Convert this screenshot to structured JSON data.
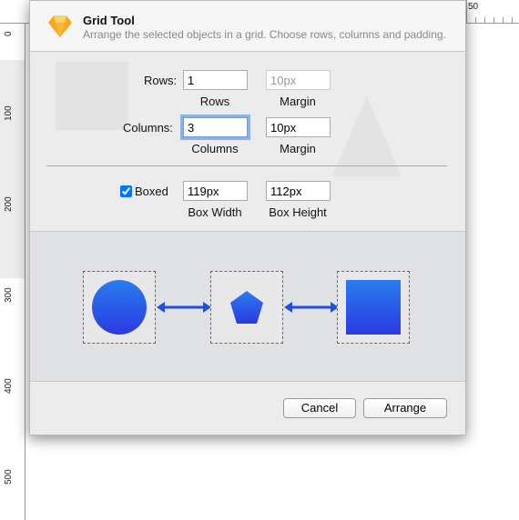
{
  "ruler": {
    "top_label": "50",
    "left_labels": [
      "0",
      "100",
      "200",
      "300",
      "400",
      "500"
    ]
  },
  "dialog": {
    "title": "Grid Tool",
    "subtitle": "Arrange the selected objects in a grid. Choose rows, columns and padding.",
    "rows": {
      "label": "Rows:",
      "value": "1",
      "caption": "Rows"
    },
    "row_margin": {
      "value": "10px",
      "caption": "Margin",
      "disabled": true
    },
    "columns": {
      "label": "Columns:",
      "value": "3",
      "caption": "Columns"
    },
    "column_margin": {
      "value": "10px",
      "caption": "Margin"
    },
    "boxed": {
      "label": "Boxed",
      "checked": true
    },
    "box_width": {
      "value": "119px",
      "caption": "Box Width"
    },
    "box_height": {
      "value": "112px",
      "caption": "Box Height"
    },
    "preview": {
      "shapes": [
        "circle",
        "pentagon",
        "square"
      ],
      "shape_gradient": [
        "#2a7cf0",
        "#2a3ae0"
      ],
      "arrow_color": "#1f4fe0"
    },
    "cancel_label": "Cancel",
    "arrange_label": "Arrange"
  }
}
